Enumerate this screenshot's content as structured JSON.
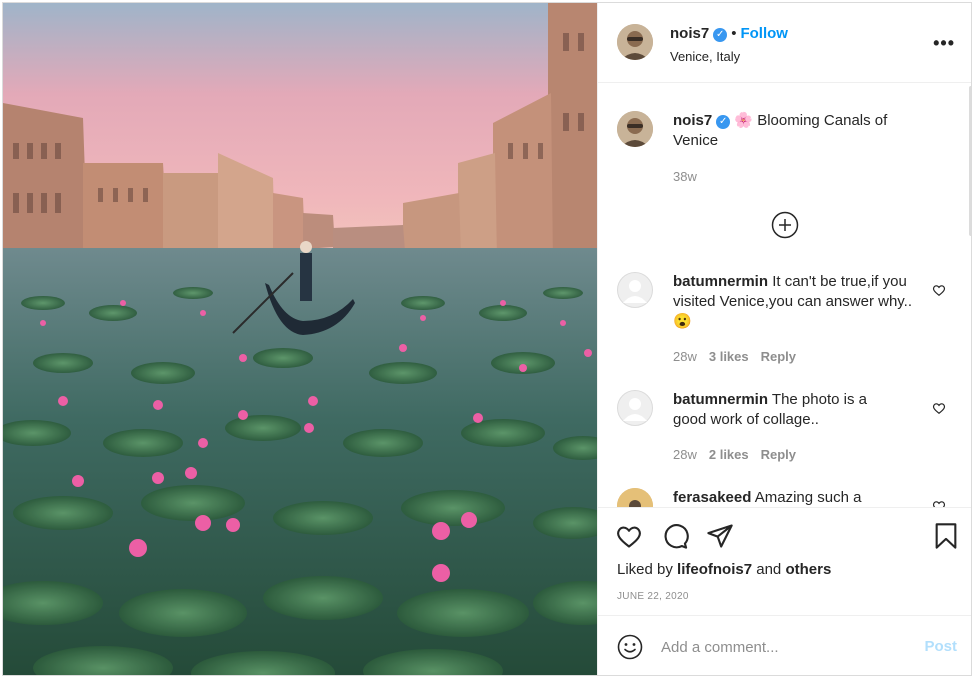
{
  "header": {
    "username": "nois7",
    "follow_label": "Follow",
    "location": "Venice, Italy"
  },
  "caption": {
    "username": "nois7",
    "flower_emoji": "🌸",
    "text": "Blooming Canals of Venice",
    "age": "38w"
  },
  "comments": [
    {
      "username": "batumnermin",
      "text": "It can't be true,if you visited Venice,you can answer why..😮",
      "age": "28w",
      "likes": "3 likes",
      "reply": "Reply"
    },
    {
      "username": "batumnermin",
      "text": "The photo is a good work of collage..",
      "age": "28w",
      "likes": "2 likes",
      "reply": "Reply"
    },
    {
      "username": "ferasakeed",
      "text": "Amazing such a"
    }
  ],
  "likes": {
    "prefix": "Liked by",
    "user": "lifeofnois7",
    "joiner": "and",
    "others": "others"
  },
  "date": "JUNE 22, 2020",
  "add_comment": {
    "placeholder": "Add a comment...",
    "post_label": "Post"
  },
  "colors": {
    "accent": "#0095f6",
    "post_disabled": "#b2dffc",
    "verified": "#3897f0",
    "muted": "#8e8e8e"
  }
}
